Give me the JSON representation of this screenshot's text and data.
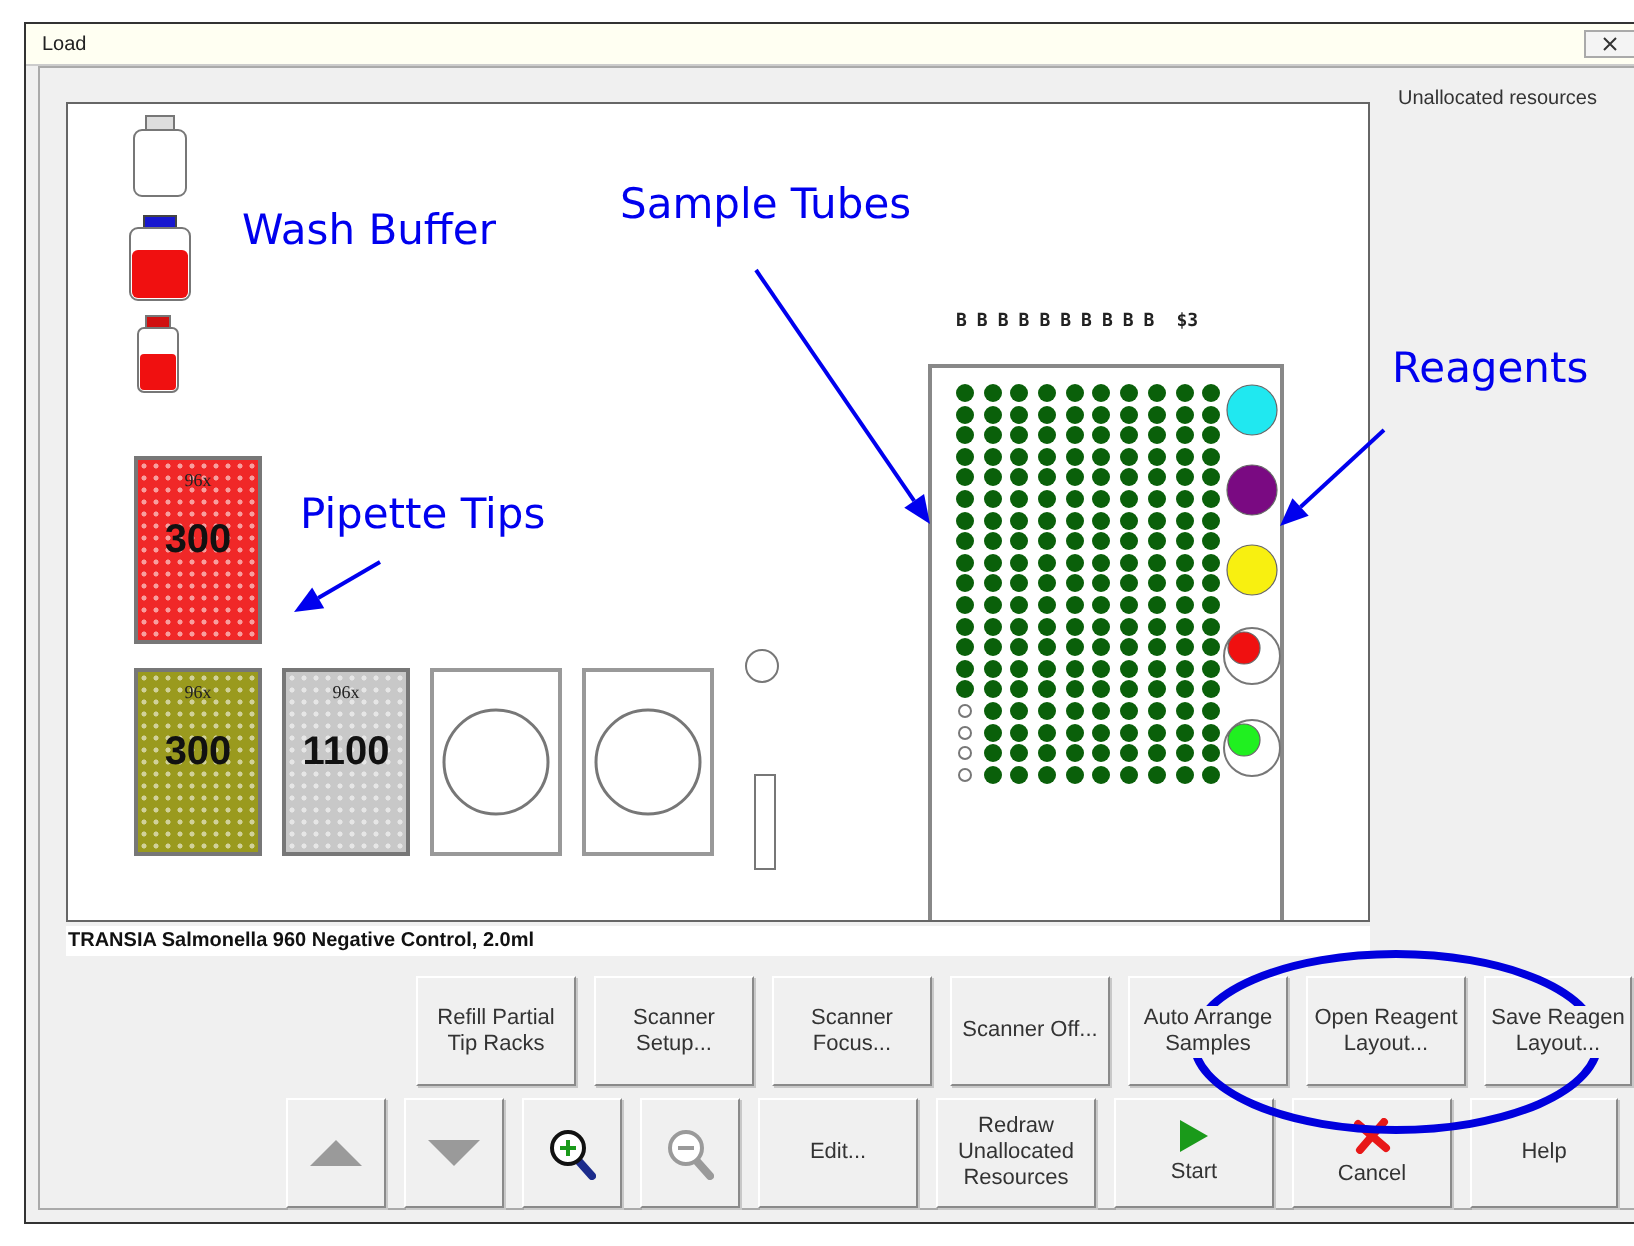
{
  "window": {
    "title": "Load"
  },
  "unallocated_label": "Unallocated resources",
  "deck": {
    "bottles": [
      {
        "kind": "empty"
      },
      {
        "kind": "full"
      },
      {
        "kind": "small"
      }
    ],
    "tip_racks": [
      {
        "count": "96x",
        "volume": "300",
        "color": "#f02828"
      },
      {
        "count": "96x",
        "volume": "300",
        "color": "#9a9a1e"
      },
      {
        "count": "96x",
        "volume": "1100",
        "color": "#c8c8c8"
      }
    ],
    "plates": [
      {
        "kind": "plate"
      },
      {
        "kind": "plate"
      }
    ],
    "misc": [
      {
        "kind": "circle"
      },
      {
        "kind": "slot"
      }
    ],
    "sample_rack": {
      "column_labels": [
        "B",
        "B",
        "B",
        "B",
        "B",
        "B",
        "B",
        "B",
        "B",
        "B",
        "$3"
      ],
      "columns": [
        {
          "tubes": [
            true,
            true,
            true,
            true,
            true,
            true,
            true,
            true,
            true,
            true,
            true,
            true,
            true,
            true,
            true,
            false,
            false,
            false,
            false
          ]
        },
        {
          "tubes": [
            true,
            true,
            true,
            true,
            true,
            true,
            true,
            true,
            true,
            true,
            true,
            true,
            true,
            true,
            true,
            true,
            true,
            true,
            true
          ]
        },
        {
          "tubes": [
            true,
            true,
            true,
            true,
            true,
            true,
            true,
            true,
            true,
            true,
            true,
            true,
            true,
            true,
            true,
            true,
            true,
            true,
            true
          ]
        },
        {
          "tubes": [
            true,
            true,
            true,
            true,
            true,
            true,
            true,
            true,
            true,
            true,
            true,
            true,
            true,
            true,
            true,
            true,
            true,
            true,
            true
          ]
        },
        {
          "tubes": [
            true,
            true,
            true,
            true,
            true,
            true,
            true,
            true,
            true,
            true,
            true,
            true,
            true,
            true,
            true,
            true,
            true,
            true,
            true
          ]
        },
        {
          "tubes": [
            true,
            true,
            true,
            true,
            true,
            true,
            true,
            true,
            true,
            true,
            true,
            true,
            true,
            true,
            true,
            true,
            true,
            true,
            true
          ]
        },
        {
          "tubes": [
            true,
            true,
            true,
            true,
            true,
            true,
            true,
            true,
            true,
            true,
            true,
            true,
            true,
            true,
            true,
            true,
            true,
            true,
            true
          ]
        },
        {
          "tubes": [
            true,
            true,
            true,
            true,
            true,
            true,
            true,
            true,
            true,
            true,
            true,
            true,
            true,
            true,
            true,
            true,
            true,
            true,
            true
          ]
        },
        {
          "tubes": [
            true,
            true,
            true,
            true,
            true,
            true,
            true,
            true,
            true,
            true,
            true,
            true,
            true,
            true,
            true,
            true,
            true,
            true,
            true
          ]
        },
        {
          "tubes": [
            true,
            true,
            true,
            true,
            true,
            true,
            true,
            true,
            true,
            true,
            true,
            true,
            true,
            true,
            true,
            true,
            true,
            true,
            true
          ]
        }
      ],
      "reagents": [
        {
          "color": "#20e8f0",
          "ring": false
        },
        {
          "color": "#7a0a82",
          "ring": false
        },
        {
          "color": "#f8f010",
          "ring": false
        },
        {
          "color": "#f01010",
          "ring": true
        },
        {
          "color": "#20f020",
          "ring": true
        }
      ]
    }
  },
  "status_text": "TRANSIA Salmonella 960 Negative Control, 2.0ml",
  "buttons_top": [
    {
      "label": "Refill Partial\nTip Racks"
    },
    {
      "label": "Scanner\nSetup..."
    },
    {
      "label": "Scanner\nFocus..."
    },
    {
      "label": "Scanner Off..."
    },
    {
      "label": "Auto Arrange\nSamples"
    },
    {
      "label": "Open Reagent\nLayout..."
    },
    {
      "label": "Save Reagen\nLayout..."
    }
  ],
  "buttons_bottom": [
    {
      "kind": "arrow_up",
      "disabled": true
    },
    {
      "kind": "arrow_down",
      "disabled": true
    },
    {
      "kind": "zoom_in",
      "disabled": false
    },
    {
      "kind": "zoom_out",
      "disabled": true
    },
    {
      "kind": "text",
      "label": "Edit...",
      "disabled": false
    },
    {
      "kind": "text",
      "label": "Redraw\nUnallocated\nResources",
      "disabled": false
    },
    {
      "kind": "start",
      "label": "Start",
      "disabled": false
    },
    {
      "kind": "cancel",
      "label": "Cancel",
      "disabled": false
    },
    {
      "kind": "text",
      "label": "Help",
      "disabled": false
    }
  ],
  "annotations": [
    {
      "kind": "label",
      "text": "Wash Buffer"
    },
    {
      "kind": "arrow_label",
      "text": "Sample Tubes"
    },
    {
      "kind": "arrow_label",
      "text": "Reagents"
    },
    {
      "kind": "arrow_label",
      "text": "Pipette Tips"
    },
    {
      "kind": "ellipse"
    }
  ]
}
